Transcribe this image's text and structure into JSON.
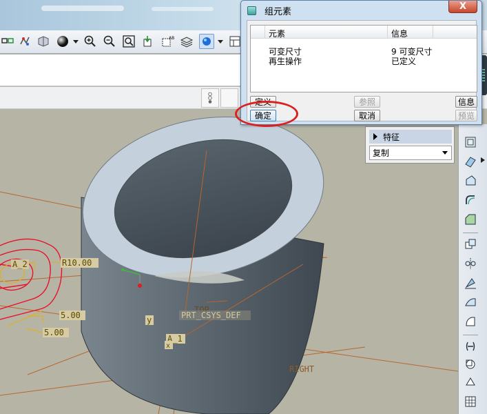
{
  "dialog": {
    "title": "组元素",
    "close_label": "X",
    "columns": [
      "元素",
      "信息"
    ],
    "rows": [
      {
        "element": "可变尺寸",
        "info": "9 可变尺寸"
      },
      {
        "element": "再生操作",
        "info": "已定义"
      }
    ],
    "buttons": {
      "define": "定义",
      "reference": "参照",
      "info": "信息",
      "ok": "确定",
      "cancel": "取消",
      "preview": "预览"
    }
  },
  "menu": {
    "header": "特征",
    "select_value": "复制"
  },
  "model_labels": {
    "r_dim": "R10.00",
    "dim_5a": "5.00",
    "dim_5b": "5.00",
    "top": "TOP",
    "csys": "PRT_CSYS_DEF",
    "right": "RIGHT",
    "y_axis": "y",
    "a1": "A_1",
    "a2": "A_2",
    "x_axis": "x"
  },
  "colors": {
    "viewport_bg": "#b6b4a5",
    "part_body": "#5f6a73",
    "part_top": "#c4d1dc",
    "datum_line": "#b8662e",
    "sketch": "#e8102a",
    "dim_text_bg": "#d6cba3",
    "highlight": "#d9221f"
  },
  "icons": {
    "toolbar": [
      "sketch-icon",
      "regenerate-icon",
      "layer-icon",
      "shading-sphere-icon",
      "zoom-in-icon",
      "zoom-out-icon",
      "zoom-fit-icon",
      "orient-icon",
      "saved-views-icon",
      "layers-icon",
      "display-style-icon"
    ],
    "right_toolbar": [
      "datum-plane-icon",
      "datum-axis-icon",
      "sweep-icon",
      "round-icon",
      "chamfer-icon",
      "copy-icon",
      "mirror-icon",
      "pattern-icon",
      "surface-icon",
      "draft-icon",
      "shell-icon",
      "rib-icon",
      "thicken-icon",
      "grid-icon"
    ]
  }
}
